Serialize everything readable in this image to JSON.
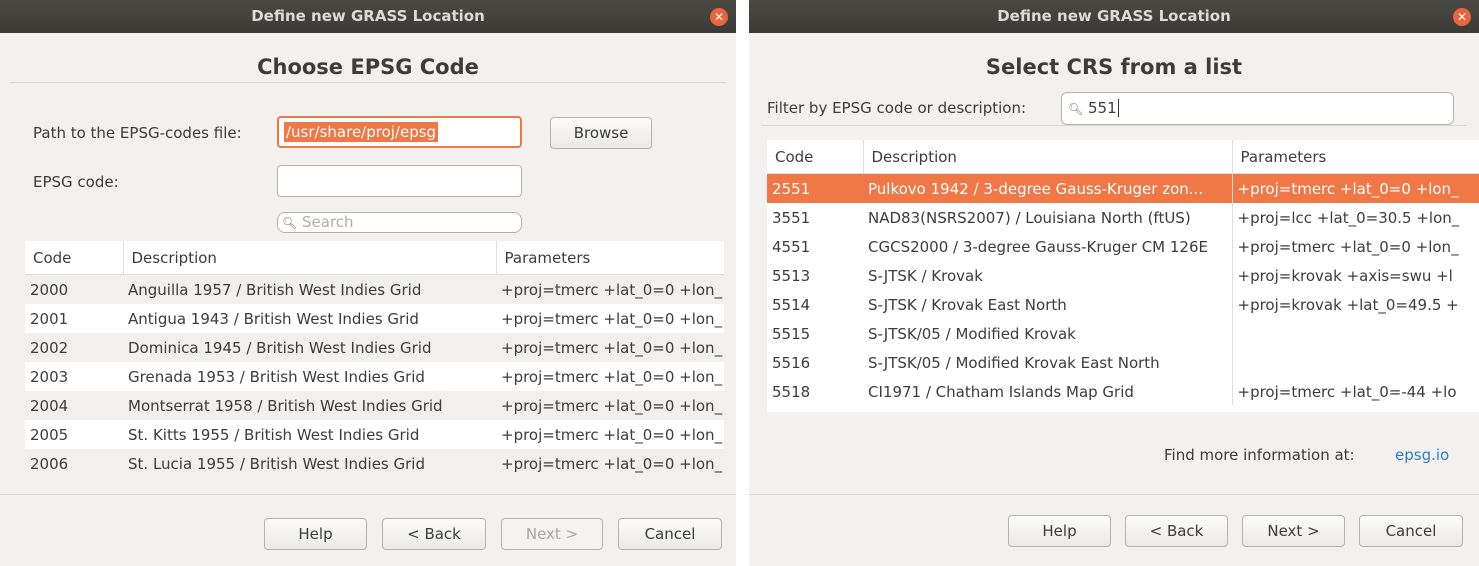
{
  "left_dialog": {
    "title": "Define new GRASS Location",
    "heading": "Choose EPSG Code",
    "path_label": "Path to the EPSG-codes file:",
    "path_value": "/usr/share/proj/epsg",
    "browse_label": "Browse",
    "epsg_label": "EPSG code:",
    "epsg_value": "",
    "search_placeholder": "Search",
    "columns": [
      "Code",
      "Description",
      "Parameters"
    ],
    "rows": [
      {
        "code": "2000",
        "desc": "Anguilla 1957 / British West Indies Grid",
        "params": "+proj=tmerc +lat_0=0 +lon_"
      },
      {
        "code": "2001",
        "desc": "Antigua 1943 / British West Indies Grid",
        "params": "+proj=tmerc +lat_0=0 +lon_"
      },
      {
        "code": "2002",
        "desc": "Dominica 1945 / British West Indies Grid",
        "params": "+proj=tmerc +lat_0=0 +lon_"
      },
      {
        "code": "2003",
        "desc": "Grenada 1953 / British West Indies Grid",
        "params": "+proj=tmerc +lat_0=0 +lon_"
      },
      {
        "code": "2004",
        "desc": "Montserrat 1958 / British West Indies Grid",
        "params": "+proj=tmerc +lat_0=0 +lon_"
      },
      {
        "code": "2005",
        "desc": "St. Kitts 1955 / British West Indies Grid",
        "params": "+proj=tmerc +lat_0=0 +lon_"
      },
      {
        "code": "2006",
        "desc": "St. Lucia 1955 / British West Indies Grid",
        "params": "+proj=tmerc +lat_0=0 +lon_"
      }
    ],
    "buttons": {
      "help": "Help",
      "back": "< Back",
      "next": "Next >",
      "cancel": "Cancel"
    }
  },
  "right_dialog": {
    "title": "Define new GRASS Location",
    "heading": "Select CRS from a list",
    "filter_label": "Filter by EPSG code or description:",
    "filter_value": "551",
    "columns": [
      "Code",
      "Description",
      "Parameters"
    ],
    "rows": [
      {
        "code": "2551",
        "desc": "Pulkovo 1942 / 3-degree Gauss-Kruger zon...",
        "params": "+proj=tmerc +lat_0=0 +lon_"
      },
      {
        "code": "3551",
        "desc": "NAD83(NSRS2007) / Louisiana North (ftUS)",
        "params": "+proj=lcc +lat_0=30.5 +lon_"
      },
      {
        "code": "4551",
        "desc": "CGCS2000 / 3-degree Gauss-Kruger CM 126E",
        "params": "+proj=tmerc +lat_0=0 +lon_"
      },
      {
        "code": "5513",
        "desc": "S-JTSK / Krovak",
        "params": "+proj=krovak +axis=swu +l"
      },
      {
        "code": "5514",
        "desc": "S-JTSK / Krovak East North",
        "params": "+proj=krovak +lat_0=49.5 +"
      },
      {
        "code": "5515",
        "desc": "S-JTSK/05 / Modified Krovak",
        "params": ""
      },
      {
        "code": "5516",
        "desc": "S-JTSK/05 / Modified Krovak East North",
        "params": ""
      },
      {
        "code": "5518",
        "desc": "CI1971 / Chatham Islands Map Grid",
        "params": "+proj=tmerc +lat_0=-44 +lo"
      }
    ],
    "info_label": "Find more information at:",
    "info_link": "epsg.io",
    "buttons": {
      "help": "Help",
      "back": "< Back",
      "next": "Next >",
      "cancel": "Cancel"
    }
  },
  "colors": {
    "titlebar": "#3b3a36",
    "selection": "#f07746",
    "close": "#e8653e",
    "link": "#2a7fba"
  }
}
